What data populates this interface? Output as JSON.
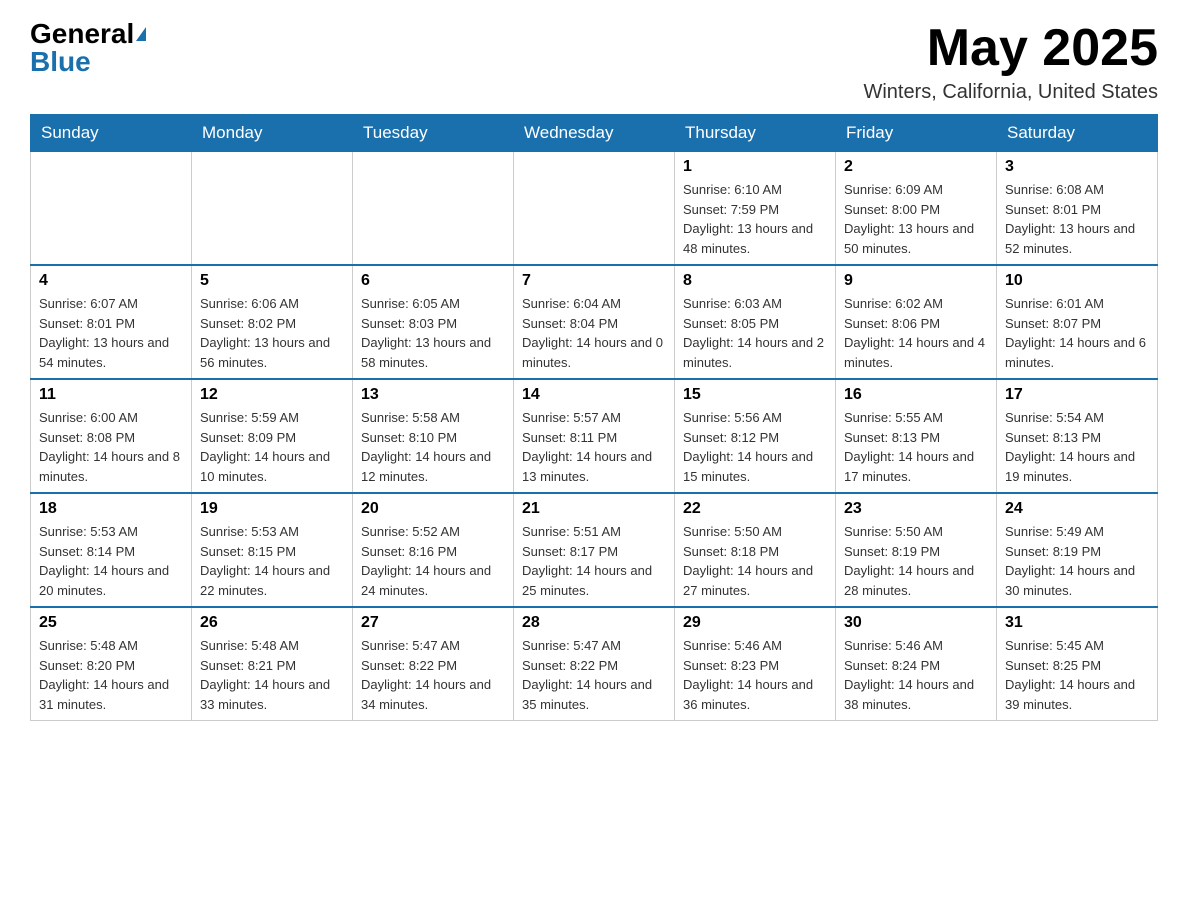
{
  "header": {
    "logo_general": "General",
    "logo_blue": "Blue",
    "month_year": "May 2025",
    "location": "Winters, California, United States"
  },
  "weekdays": [
    "Sunday",
    "Monday",
    "Tuesday",
    "Wednesday",
    "Thursday",
    "Friday",
    "Saturday"
  ],
  "weeks": [
    [
      {
        "day": "",
        "info": ""
      },
      {
        "day": "",
        "info": ""
      },
      {
        "day": "",
        "info": ""
      },
      {
        "day": "",
        "info": ""
      },
      {
        "day": "1",
        "info": "Sunrise: 6:10 AM\nSunset: 7:59 PM\nDaylight: 13 hours and 48 minutes."
      },
      {
        "day": "2",
        "info": "Sunrise: 6:09 AM\nSunset: 8:00 PM\nDaylight: 13 hours and 50 minutes."
      },
      {
        "day": "3",
        "info": "Sunrise: 6:08 AM\nSunset: 8:01 PM\nDaylight: 13 hours and 52 minutes."
      }
    ],
    [
      {
        "day": "4",
        "info": "Sunrise: 6:07 AM\nSunset: 8:01 PM\nDaylight: 13 hours and 54 minutes."
      },
      {
        "day": "5",
        "info": "Sunrise: 6:06 AM\nSunset: 8:02 PM\nDaylight: 13 hours and 56 minutes."
      },
      {
        "day": "6",
        "info": "Sunrise: 6:05 AM\nSunset: 8:03 PM\nDaylight: 13 hours and 58 minutes."
      },
      {
        "day": "7",
        "info": "Sunrise: 6:04 AM\nSunset: 8:04 PM\nDaylight: 14 hours and 0 minutes."
      },
      {
        "day": "8",
        "info": "Sunrise: 6:03 AM\nSunset: 8:05 PM\nDaylight: 14 hours and 2 minutes."
      },
      {
        "day": "9",
        "info": "Sunrise: 6:02 AM\nSunset: 8:06 PM\nDaylight: 14 hours and 4 minutes."
      },
      {
        "day": "10",
        "info": "Sunrise: 6:01 AM\nSunset: 8:07 PM\nDaylight: 14 hours and 6 minutes."
      }
    ],
    [
      {
        "day": "11",
        "info": "Sunrise: 6:00 AM\nSunset: 8:08 PM\nDaylight: 14 hours and 8 minutes."
      },
      {
        "day": "12",
        "info": "Sunrise: 5:59 AM\nSunset: 8:09 PM\nDaylight: 14 hours and 10 minutes."
      },
      {
        "day": "13",
        "info": "Sunrise: 5:58 AM\nSunset: 8:10 PM\nDaylight: 14 hours and 12 minutes."
      },
      {
        "day": "14",
        "info": "Sunrise: 5:57 AM\nSunset: 8:11 PM\nDaylight: 14 hours and 13 minutes."
      },
      {
        "day": "15",
        "info": "Sunrise: 5:56 AM\nSunset: 8:12 PM\nDaylight: 14 hours and 15 minutes."
      },
      {
        "day": "16",
        "info": "Sunrise: 5:55 AM\nSunset: 8:13 PM\nDaylight: 14 hours and 17 minutes."
      },
      {
        "day": "17",
        "info": "Sunrise: 5:54 AM\nSunset: 8:13 PM\nDaylight: 14 hours and 19 minutes."
      }
    ],
    [
      {
        "day": "18",
        "info": "Sunrise: 5:53 AM\nSunset: 8:14 PM\nDaylight: 14 hours and 20 minutes."
      },
      {
        "day": "19",
        "info": "Sunrise: 5:53 AM\nSunset: 8:15 PM\nDaylight: 14 hours and 22 minutes."
      },
      {
        "day": "20",
        "info": "Sunrise: 5:52 AM\nSunset: 8:16 PM\nDaylight: 14 hours and 24 minutes."
      },
      {
        "day": "21",
        "info": "Sunrise: 5:51 AM\nSunset: 8:17 PM\nDaylight: 14 hours and 25 minutes."
      },
      {
        "day": "22",
        "info": "Sunrise: 5:50 AM\nSunset: 8:18 PM\nDaylight: 14 hours and 27 minutes."
      },
      {
        "day": "23",
        "info": "Sunrise: 5:50 AM\nSunset: 8:19 PM\nDaylight: 14 hours and 28 minutes."
      },
      {
        "day": "24",
        "info": "Sunrise: 5:49 AM\nSunset: 8:19 PM\nDaylight: 14 hours and 30 minutes."
      }
    ],
    [
      {
        "day": "25",
        "info": "Sunrise: 5:48 AM\nSunset: 8:20 PM\nDaylight: 14 hours and 31 minutes."
      },
      {
        "day": "26",
        "info": "Sunrise: 5:48 AM\nSunset: 8:21 PM\nDaylight: 14 hours and 33 minutes."
      },
      {
        "day": "27",
        "info": "Sunrise: 5:47 AM\nSunset: 8:22 PM\nDaylight: 14 hours and 34 minutes."
      },
      {
        "day": "28",
        "info": "Sunrise: 5:47 AM\nSunset: 8:22 PM\nDaylight: 14 hours and 35 minutes."
      },
      {
        "day": "29",
        "info": "Sunrise: 5:46 AM\nSunset: 8:23 PM\nDaylight: 14 hours and 36 minutes."
      },
      {
        "day": "30",
        "info": "Sunrise: 5:46 AM\nSunset: 8:24 PM\nDaylight: 14 hours and 38 minutes."
      },
      {
        "day": "31",
        "info": "Sunrise: 5:45 AM\nSunset: 8:25 PM\nDaylight: 14 hours and 39 minutes."
      }
    ]
  ]
}
